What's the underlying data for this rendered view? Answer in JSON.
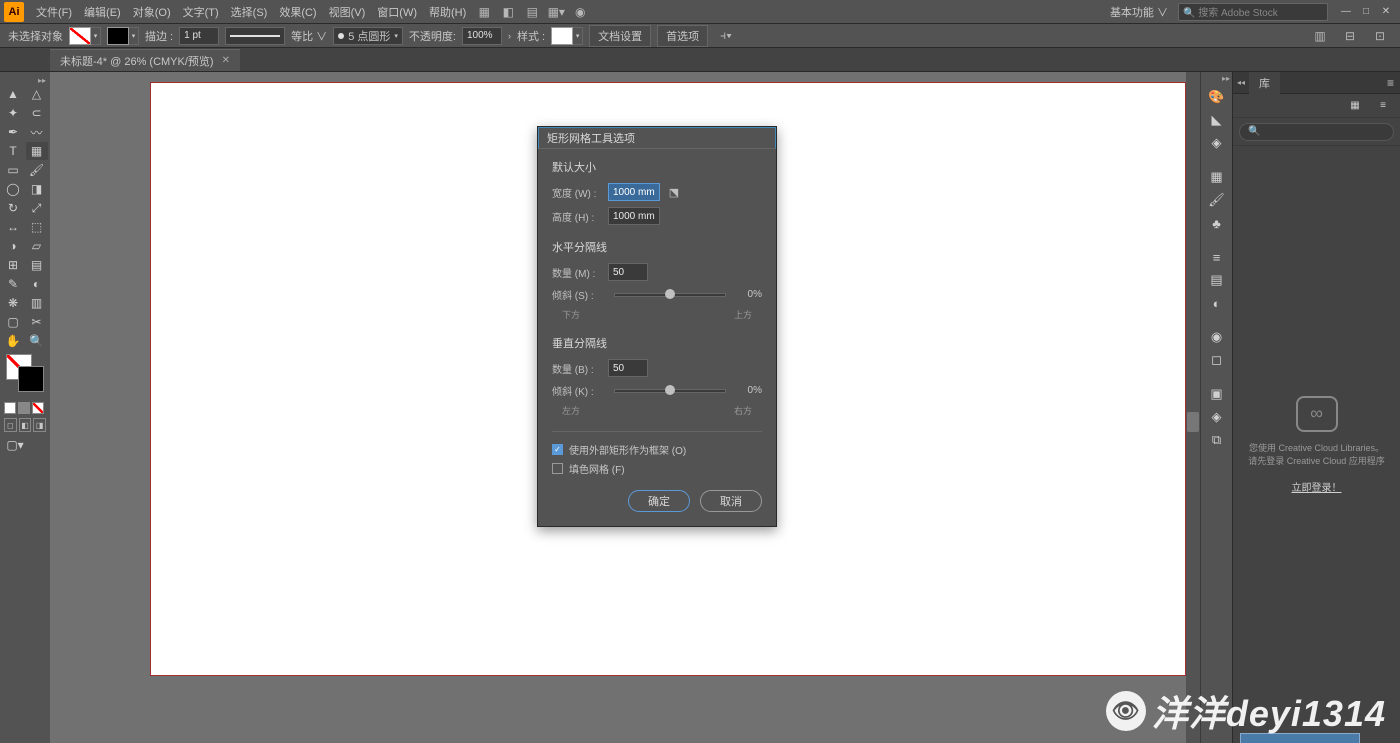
{
  "app": {
    "logo": "Ai"
  },
  "menu": {
    "file": "文件(F)",
    "edit": "编辑(E)",
    "object": "对象(O)",
    "type": "文字(T)",
    "select": "选择(S)",
    "effect": "效果(C)",
    "view": "视图(V)",
    "window": "窗口(W)",
    "help": "帮助(H)"
  },
  "top_right": {
    "essentials": "基本功能 ∨",
    "search_placeholder": "🔍 搜索 Adobe Stock"
  },
  "control": {
    "no_selection": "未选择对象",
    "stroke_label": "描边 :",
    "stroke_val": "1 pt",
    "uniform": "等比 ∨",
    "pt_round": "5 点圆形",
    "opacity_label": "不透明度:",
    "opacity_val": "100%",
    "style_label": "样式 :",
    "doc_setup": "文档设置",
    "prefs": "首选项"
  },
  "tab": {
    "title": "未标题-4* @ 26% (CMYK/预览)"
  },
  "dialog": {
    "title": "矩形网格工具选项",
    "default_size": "默认大小",
    "width_label": "宽度 (W) :",
    "width_val": "1000 mm",
    "height_label": "高度 (H) :",
    "height_val": "1000 mm",
    "h_dividers": "水平分隔线",
    "h_count_label": "数量 (M) :",
    "h_count_val": "50",
    "h_skew_label": "倾斜 (S) :",
    "h_skew_val": "0%",
    "h_bottom": "下方",
    "h_top": "上方",
    "v_dividers": "垂直分隔线",
    "v_count_label": "数量 (B) :",
    "v_count_val": "50",
    "v_skew_label": "倾斜 (K) :",
    "v_skew_val": "0%",
    "v_left": "左方",
    "v_right": "右方",
    "use_outer": "使用外部矩形作为框架 (O)",
    "fill_grid": "填色网格 (F)",
    "ok": "确定",
    "cancel": "取消"
  },
  "library": {
    "tab": "库",
    "empty1": "您使用 Creative Cloud Libraries。",
    "empty2": "请先登录 Creative Cloud 应用程序",
    "link": "立即登录！"
  },
  "watermark": {
    "text": "洋洋deyi1314"
  }
}
